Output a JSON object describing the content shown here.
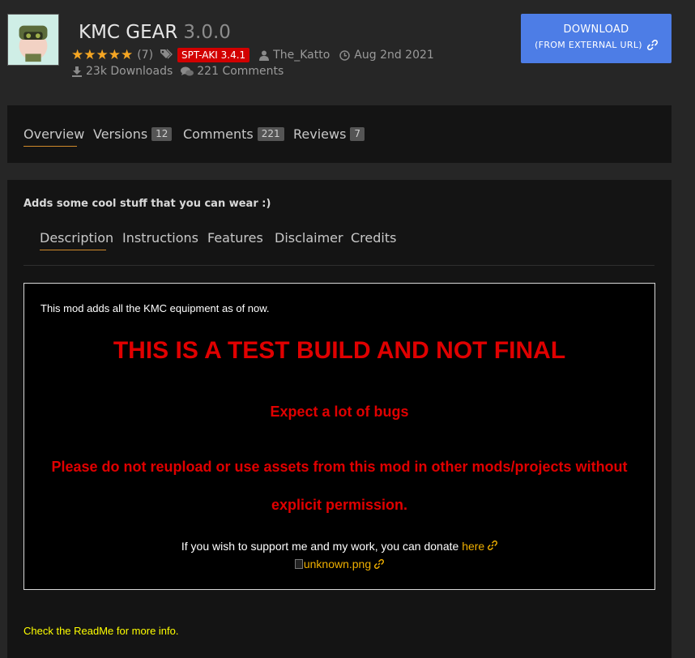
{
  "header": {
    "mod_name": "KMC GEAR",
    "version": "3.0.0",
    "rating_count": "(7)",
    "rating_stars": 5,
    "tag": "SPT-AKI 3.4.1",
    "author": "The_Katto",
    "date": "Aug 2nd 2021",
    "downloads": "23k Downloads",
    "comments": "221 Comments"
  },
  "download": {
    "line1": "DOWNLOAD",
    "line2": "(FROM EXTERNAL URL)"
  },
  "tabs": [
    {
      "label": "Overview",
      "count": ""
    },
    {
      "label": "Versions",
      "count": "12"
    },
    {
      "label": "Comments",
      "count": "221"
    },
    {
      "label": "Reviews",
      "count": "7"
    }
  ],
  "summary": "Adds some cool stuff that you can wear :)",
  "sub_tabs": [
    "Description",
    "Instructions",
    "Features",
    "Disclaimer",
    "Credits"
  ],
  "description": {
    "intro": "This mod adds all the KMC equipment as of now.",
    "headline": "THIS IS A TEST BUILD AND NOT FINAL",
    "warning": "Expect a lot of bugs",
    "notice_line1": "Please do not reupload or use assets from this mod in other mods/projects without",
    "notice_line2": "explicit permission.",
    "support_text": "If you wish to support me and my work, you can donate ",
    "support_link": "here",
    "image_alt": "unknown.png"
  },
  "readme": "Check the ReadMe for more info.",
  "colors": {
    "accent_blue": "#4d7de6",
    "badge_red": "#d20000",
    "tab_underline": "#d08a2a",
    "warning_red": "#e00000",
    "link_gold": "#f0b000",
    "readme_yellow": "#ffff00"
  }
}
